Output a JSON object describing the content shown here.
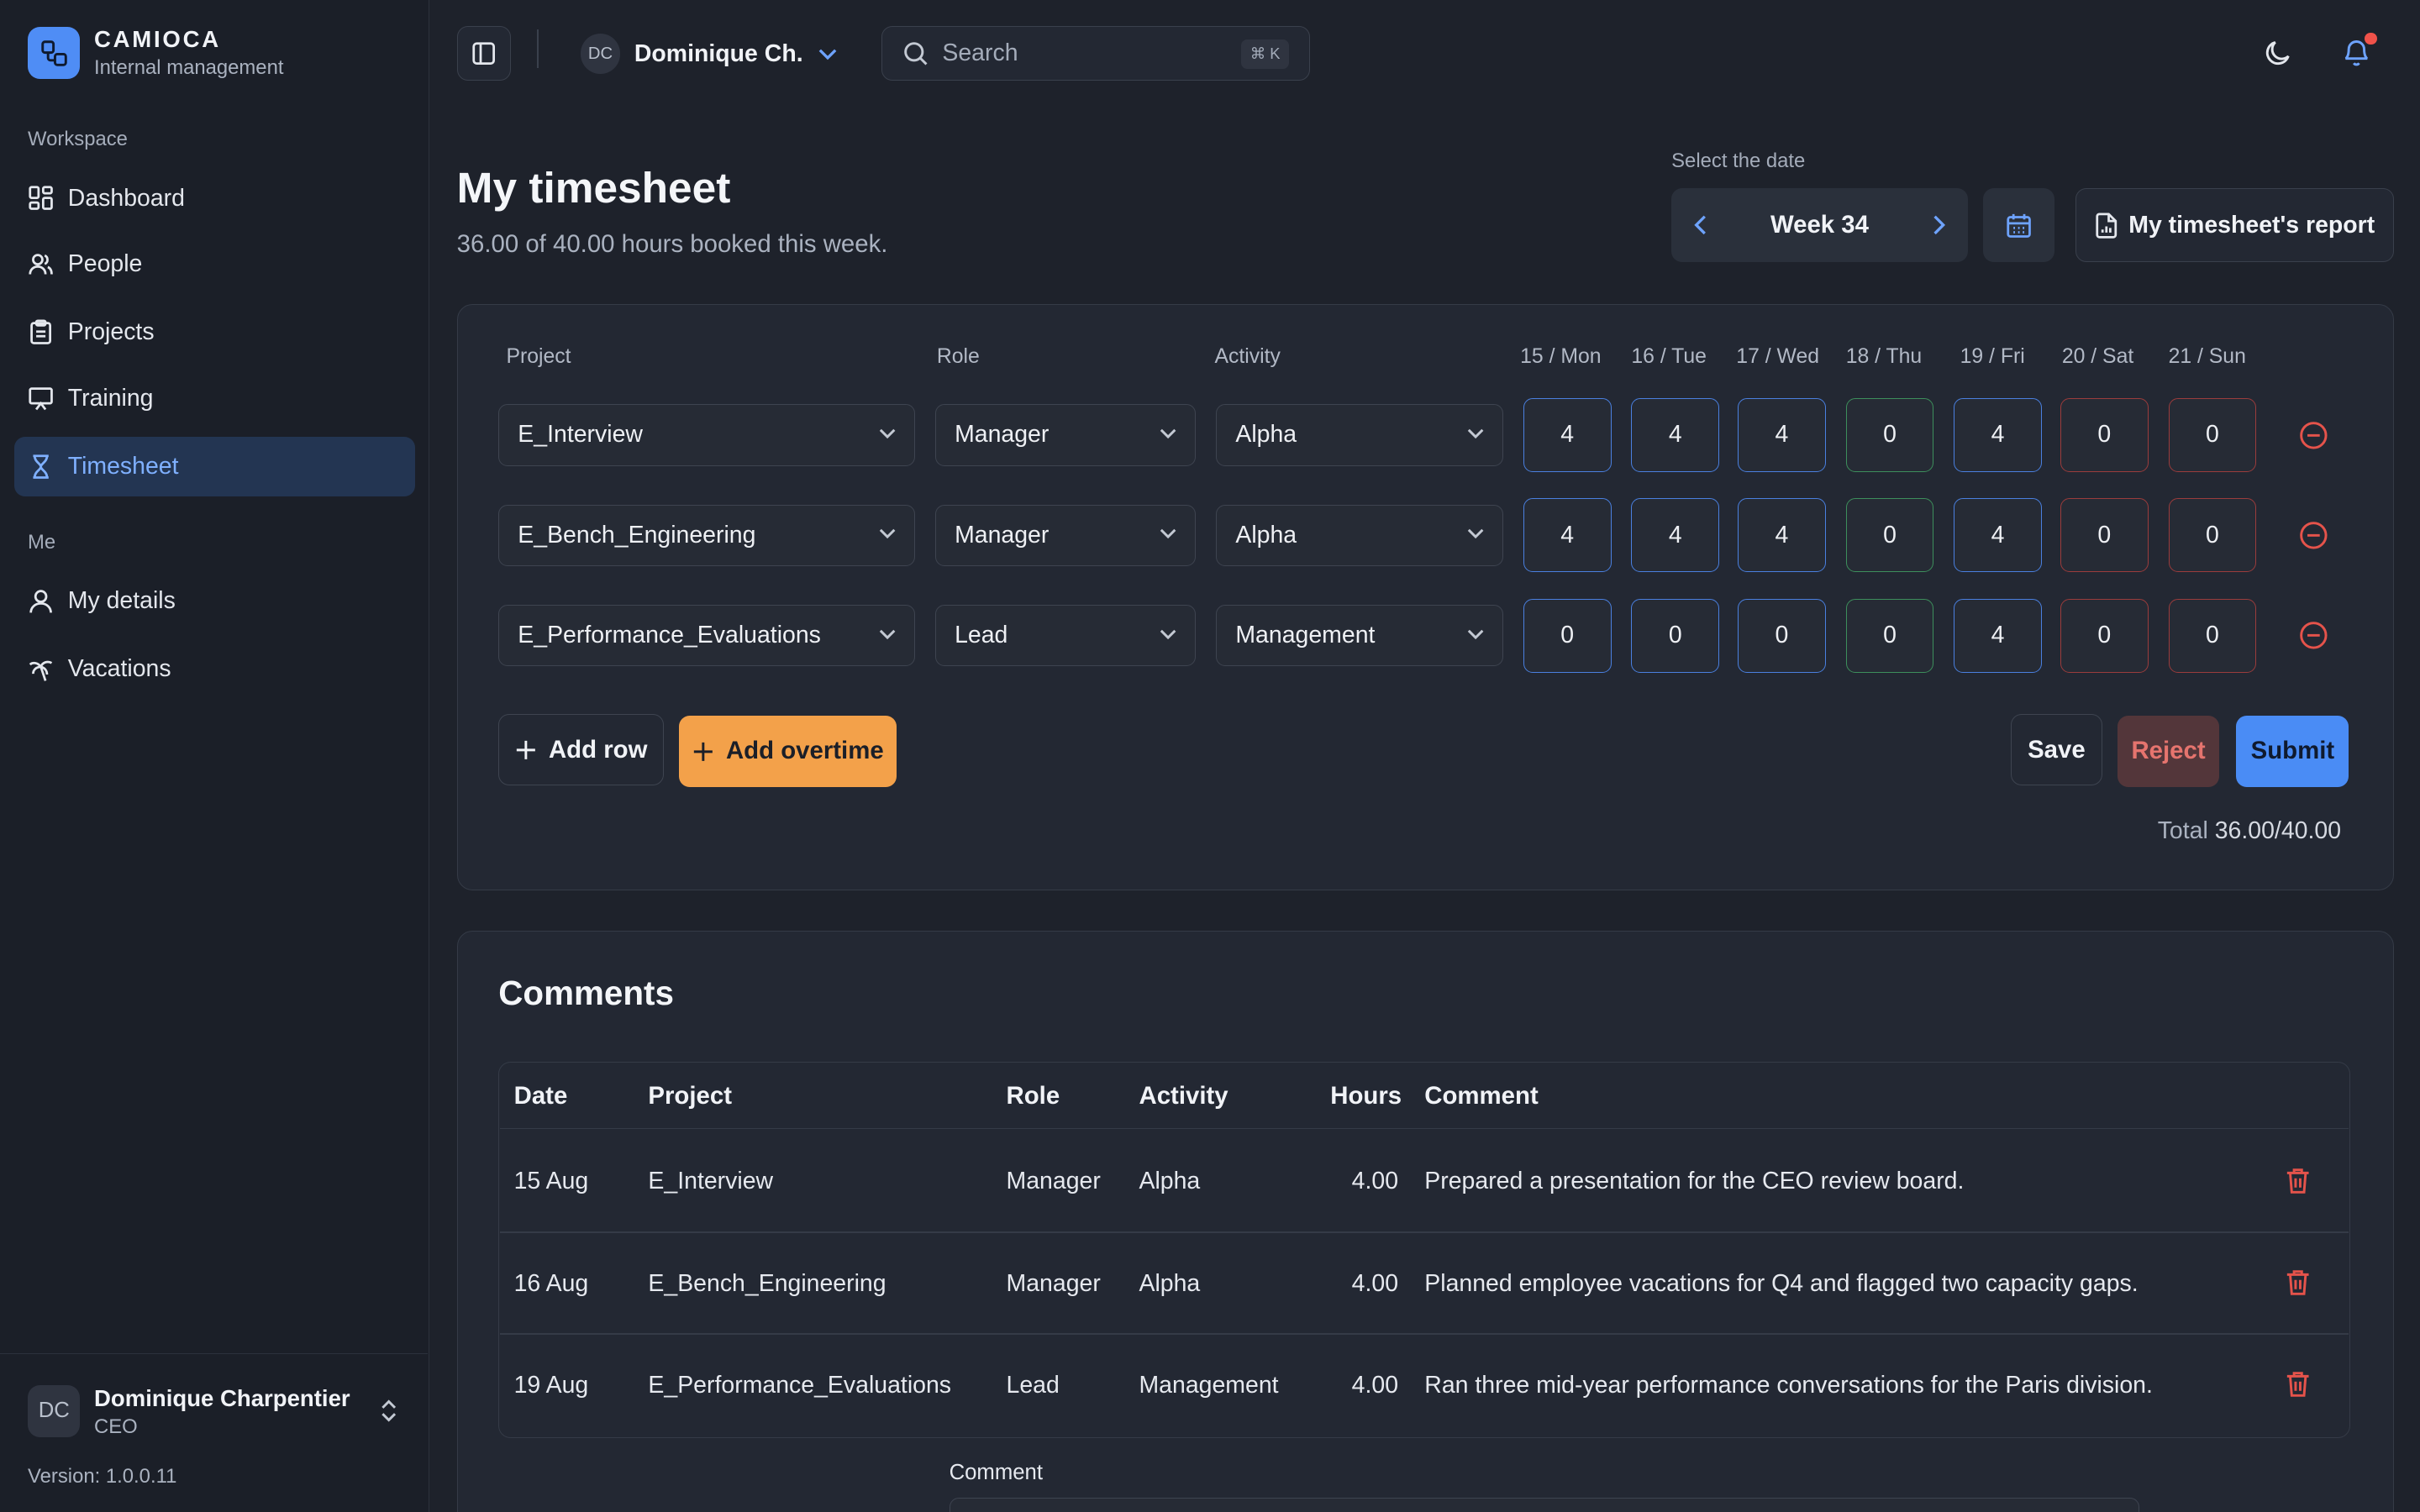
{
  "brand": {
    "name": "CAMIOCA",
    "subtitle": "Internal management"
  },
  "sidebar": {
    "workspace_label": "Workspace",
    "me_label": "Me",
    "items": [
      {
        "label": "Dashboard",
        "icon": "dashboard-icon"
      },
      {
        "label": "People",
        "icon": "people-icon"
      },
      {
        "label": "Projects",
        "icon": "clipboard-icon"
      },
      {
        "label": "Training",
        "icon": "presentation-icon"
      },
      {
        "label": "Timesheet",
        "icon": "hourglass-icon",
        "active": true
      },
      {
        "label": "My details",
        "icon": "user-icon"
      },
      {
        "label": "Vacations",
        "icon": "palm-tree-icon"
      }
    ],
    "user": {
      "initials": "DC",
      "name": "Dominique Charpentier",
      "role": "CEO"
    },
    "version": "Version: 1.0.0.11"
  },
  "topbar": {
    "account_initials": "DC",
    "account_name": "Dominique Ch.",
    "search_placeholder": "Search",
    "search_shortcut": "⌘ K"
  },
  "header": {
    "title": "My timesheet",
    "subtitle": "36.00 of 40.00 hours booked this week.",
    "date_label": "Select the date",
    "week": "Week 34",
    "report_button": "My timesheet's report"
  },
  "timesheet": {
    "columns": {
      "project": "Project",
      "role": "Role",
      "activity": "Activity"
    },
    "days": [
      "15 / Mon",
      "16 / Tue",
      "17 / Wed",
      "18 / Thu",
      "19 / Fri",
      "20 / Sat",
      "21 / Sun"
    ],
    "rows": [
      {
        "project": "E_Interview",
        "role": "Manager",
        "activity": "Alpha",
        "hours": [
          "4",
          "4",
          "4",
          "0",
          "4",
          "0",
          "0"
        ]
      },
      {
        "project": "E_Bench_Engineering",
        "role": "Manager",
        "activity": "Alpha",
        "hours": [
          "4",
          "4",
          "4",
          "0",
          "4",
          "0",
          "0"
        ]
      },
      {
        "project": "E_Performance_Evaluations",
        "role": "Lead",
        "activity": "Management",
        "hours": [
          "0",
          "0",
          "0",
          "0",
          "4",
          "0",
          "0"
        ]
      }
    ],
    "add_row": "Add row",
    "add_overtime": "Add overtime",
    "save": "Save",
    "reject": "Reject",
    "submit": "Submit",
    "total_label": "Total",
    "total_value": "36.00/40.00"
  },
  "comments": {
    "title": "Comments",
    "headers": {
      "date": "Date",
      "project": "Project",
      "role": "Role",
      "activity": "Activity",
      "hours": "Hours",
      "comment": "Comment"
    },
    "rows": [
      {
        "date": "15 Aug",
        "project": "E_Interview",
        "role": "Manager",
        "activity": "Alpha",
        "hours": "4.00",
        "comment": "Prepared a presentation for the CEO review board."
      },
      {
        "date": "16 Aug",
        "project": "E_Bench_Engineering",
        "role": "Manager",
        "activity": "Alpha",
        "hours": "4.00",
        "comment": "Planned employee vacations for Q4 and flagged two capacity gaps."
      },
      {
        "date": "19 Aug",
        "project": "E_Performance_Evaluations",
        "role": "Lead",
        "activity": "Management",
        "hours": "4.00",
        "comment": "Ran three mid-year performance conversations for the Paris division."
      }
    ],
    "form_label": "Comment"
  },
  "colors": {
    "accent": "#4a8cf5",
    "active_nav_bg": "#233552",
    "overtime": "#f3a14a",
    "danger": "#e5534b"
  }
}
